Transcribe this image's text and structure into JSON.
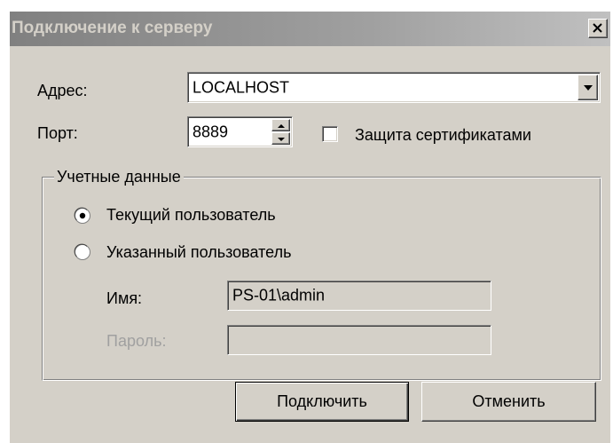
{
  "window": {
    "title": "Подключение к серверу"
  },
  "address": {
    "label": "Адрес:",
    "value": "LOCALHOST"
  },
  "port": {
    "label": "Порт:",
    "value": "8889"
  },
  "certificate": {
    "label": "Защита сертификатами",
    "checked": false
  },
  "credentials": {
    "title": "Учетные данные",
    "current_user_label": "Текущий пользователь",
    "specified_user_label": "Указанный пользователь",
    "selected": "current",
    "name_label": "Имя:",
    "name_value": "PS-01\\admin",
    "password_label": "Пароль:",
    "password_value": ""
  },
  "buttons": {
    "connect": "Подключить",
    "cancel": "Отменить"
  },
  "icons": {
    "close": "close-icon",
    "dropdown": "chevron-down-icon",
    "spin_up": "arrow-up-icon",
    "spin_down": "arrow-down-icon"
  },
  "colors": {
    "face": "#d4d0c8",
    "title_gradient_start": "#808080",
    "title_text": "#d4d0c8",
    "disabled_text": "#a0a0a0"
  }
}
